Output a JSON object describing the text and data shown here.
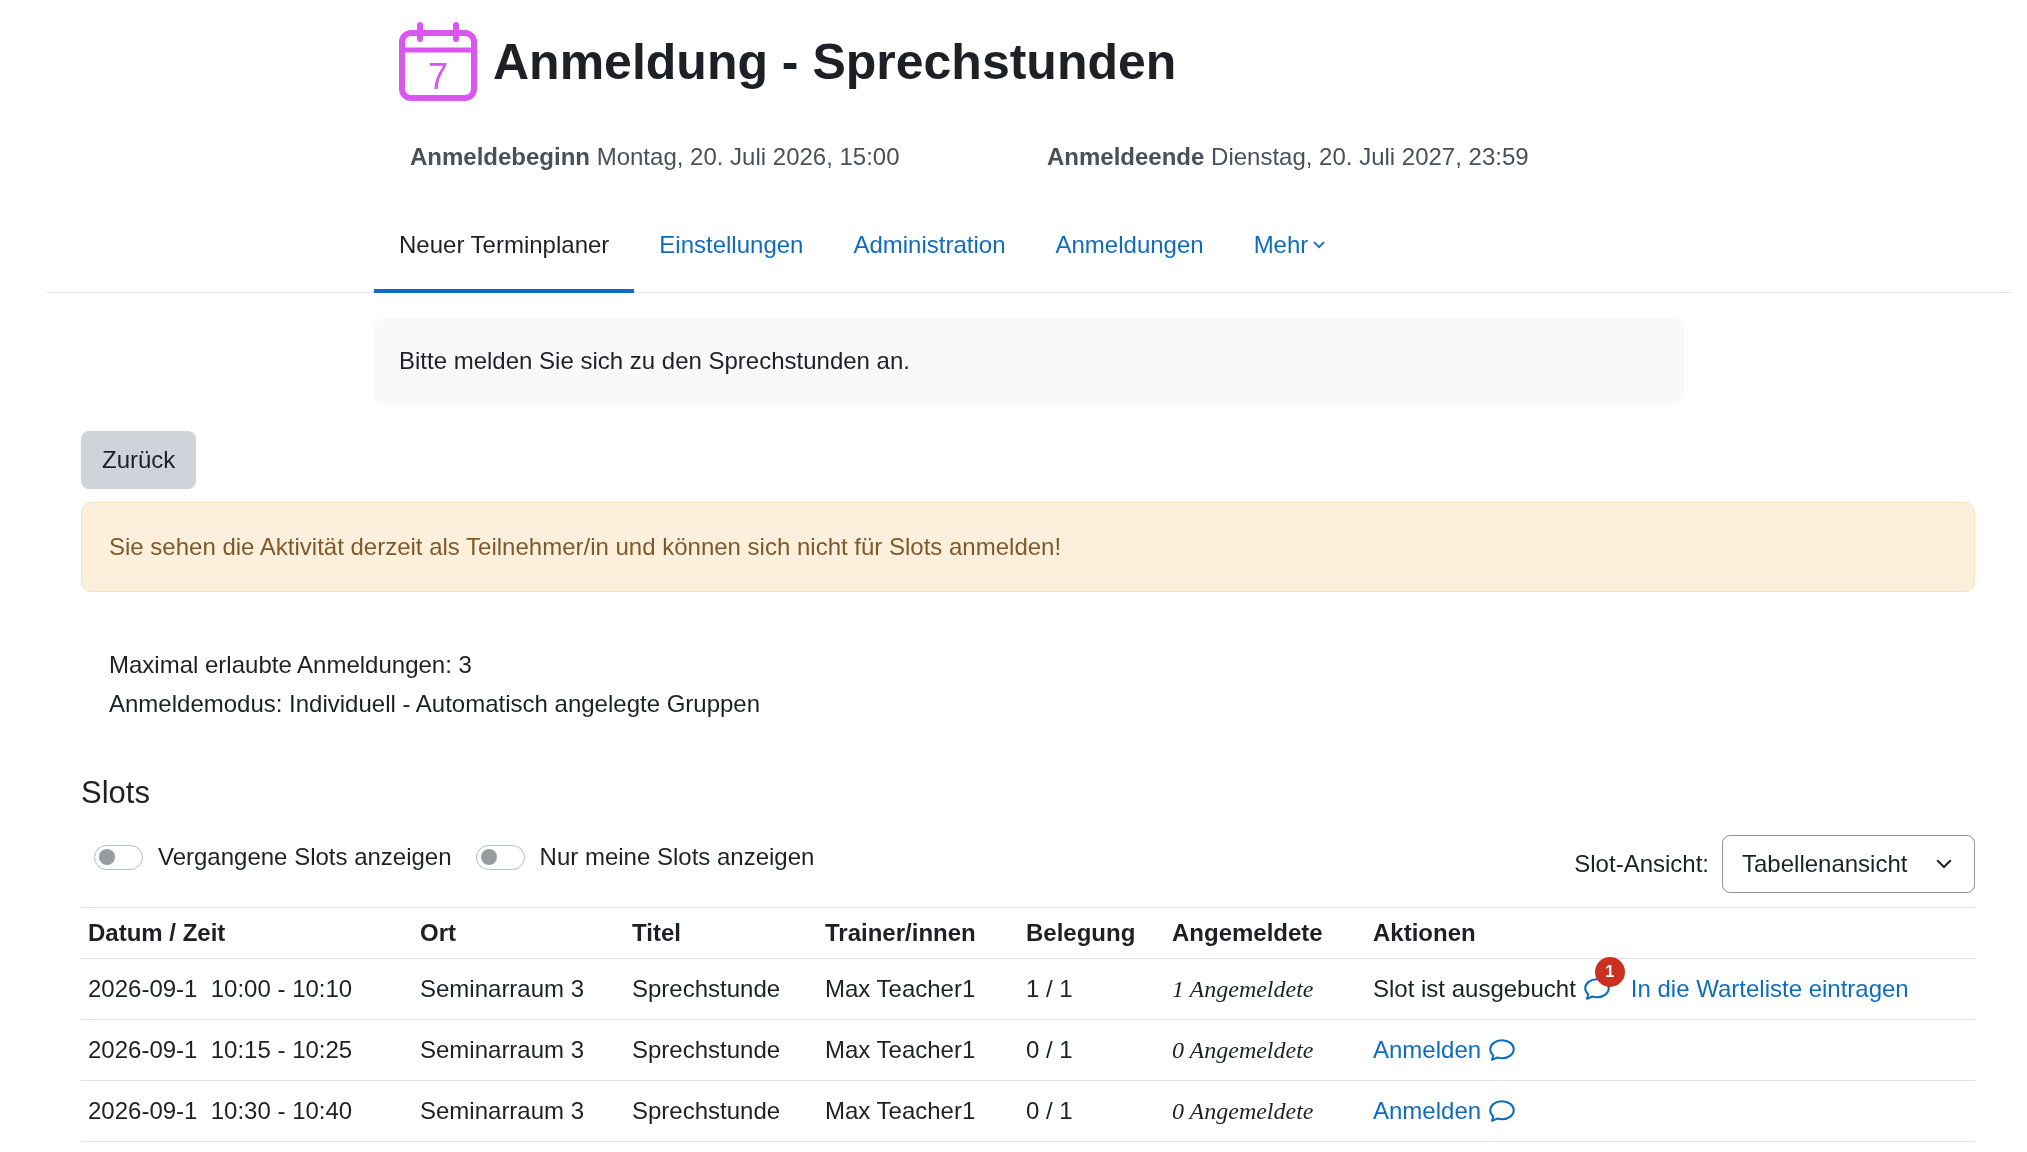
{
  "header": {
    "icon_label": "7",
    "title": "Anmeldung - Sprechstunden"
  },
  "dates": [
    {
      "label": "Anmeldebeginn",
      "value": "Montag, 20. Juli 2026, 15:00"
    },
    {
      "label": "Anmeldeende",
      "value": "Dienstag, 20. Juli 2027, 23:59"
    }
  ],
  "tabs": [
    {
      "label": "Neuer Terminplaner",
      "selected": true,
      "kind": "link"
    },
    {
      "label": "Einstellungen",
      "selected": false,
      "kind": "link"
    },
    {
      "label": "Administration",
      "selected": false,
      "kind": "link"
    },
    {
      "label": "Anmeldungen",
      "selected": false,
      "kind": "link"
    },
    {
      "label": "Mehr",
      "selected": false,
      "kind": "menu"
    }
  ],
  "intro": "Bitte melden Sie sich zu den Sprechstunden an.",
  "back_button": "Zurück",
  "warning": "Sie sehen die Aktivität derzeit als Teilnehmer/in und können sich nicht für Slots anmelden!",
  "info_lines": [
    "Maximal erlaubte Anmeldungen: 3",
    "Anmeldemodus: Individuell - Automatisch angelegte Gruppen"
  ],
  "slots": {
    "heading": "Slots",
    "toggles": [
      {
        "label": "Vergangene Slots anzeigen",
        "on": false
      },
      {
        "label": "Nur meine Slots anzeigen",
        "on": false
      }
    ],
    "view_select": {
      "label": "Slot-Ansicht:",
      "value": "Tabellenansicht"
    },
    "table": {
      "columns": [
        "Datum / Zeit",
        "Ort",
        "Titel",
        "Trainer/innen",
        "Belegung",
        "Angemeldete",
        "Aktionen"
      ],
      "rows": [
        {
          "date_time": "2026-09-1  10:00 - 10:10",
          "location": "Seminarraum 3",
          "title": "Sprechstunde",
          "trainers": "Max Teacher1",
          "occupancy": "1 / 1",
          "registered": "1 Angemeldete",
          "actions": [
            {
              "kind": "text",
              "text": "Slot ist ausgebucht"
            },
            {
              "kind": "comment",
              "badge": "1"
            },
            {
              "kind": "link",
              "text": "In die Warteliste eintragen"
            }
          ]
        },
        {
          "date_time": "2026-09-1  10:15 - 10:25",
          "location": "Seminarraum 3",
          "title": "Sprechstunde",
          "trainers": "Max Teacher1",
          "occupancy": "0 / 1",
          "registered": "0 Angemeldete",
          "actions": [
            {
              "kind": "link",
              "text": "Anmelden"
            },
            {
              "kind": "comment"
            }
          ]
        },
        {
          "date_time": "2026-09-1  10:30 - 10:40",
          "location": "Seminarraum 3",
          "title": "Sprechstunde",
          "trainers": "Max Teacher1",
          "occupancy": "0 / 1",
          "registered": "0 Angemeldete",
          "actions": [
            {
              "kind": "link",
              "text": "Anmelden"
            },
            {
              "kind": "comment"
            }
          ]
        }
      ]
    }
  }
}
